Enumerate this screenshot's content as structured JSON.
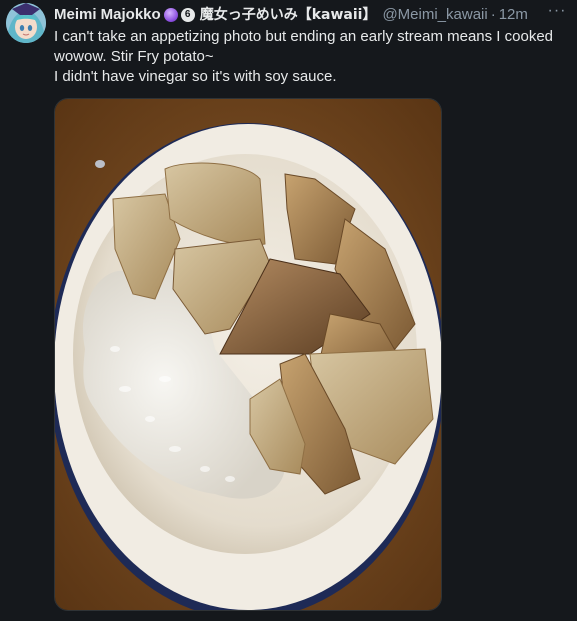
{
  "tweet": {
    "display_name": "Meimi Majokko",
    "display_name_jp": "魔女っ子めいみ【kawaii】",
    "badge_number": "6",
    "handle": "@Meimi_kawaii",
    "separator": "·",
    "time": "12m",
    "more_label": "···",
    "lines": [
      "I can't take an appetizing photo but ending an early stream means I cooked wowow. Stir Fry potato~",
      "I didn't have vinegar so it's with soy sauce."
    ]
  },
  "colors": {
    "background": "#15181c",
    "text": "#e7e9ea",
    "secondary": "#8b98a5",
    "border": "#2f3336"
  },
  "icons": {
    "avatar": "anime-avatar",
    "badge_1": "crystal-ball-icon",
    "badge_2": "number-badge-icon",
    "more": "more-horizontal-icon"
  }
}
